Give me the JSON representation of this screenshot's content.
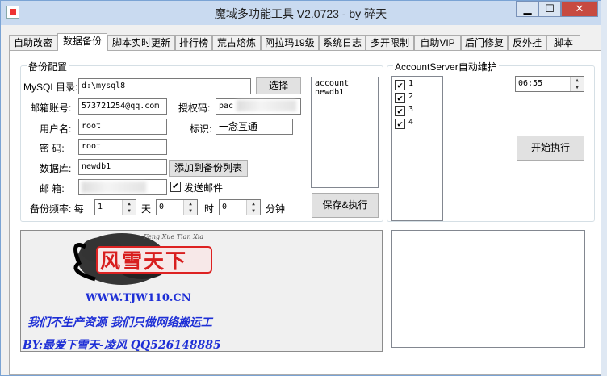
{
  "window": {
    "title": "魔域多功能工具 V2.0723 - by 碎天",
    "min_label": "▁",
    "max_label": "☐",
    "close_label": "✕"
  },
  "tabs": [
    {
      "label": "自助改密"
    },
    {
      "label": "数据备份"
    },
    {
      "label": "脚本实时更新"
    },
    {
      "label": "排行榜"
    },
    {
      "label": "荒古熔炼"
    },
    {
      "label": "阿拉玛19级"
    },
    {
      "label": "系统日志"
    },
    {
      "label": "多开限制"
    },
    {
      "label": "自助VIP"
    },
    {
      "label": "后门修复"
    },
    {
      "label": "反外挂"
    },
    {
      "label": "脚本"
    }
  ],
  "backup": {
    "group_title": "备份配置",
    "mysql_label": "MySQL目录:",
    "mysql_value": "d:\\mysql8",
    "browse_label": "选择",
    "email_account_label": "邮箱账号:",
    "email_account_value": "573721254@qq.com",
    "auth_code_label": "授权码:",
    "auth_code_value": "pac",
    "username_label": "用户名:",
    "username_value": "root",
    "tag_label": "标识:",
    "tag_value": "一念互通",
    "password_label": "密  码:",
    "password_value": "root",
    "database_label": "数据库:",
    "database_value": "newdb1",
    "add_to_list_label": "添加到备份列表",
    "mailbox_label": "邮  箱:",
    "send_mail_label": "发送邮件",
    "frequency_label": "备份频率: 每",
    "freq_day_value": "1",
    "freq_day_unit": "天",
    "freq_hour_value": "0",
    "freq_hour_unit": "时",
    "freq_min_value": "0",
    "freq_min_unit": "分钟",
    "save_execute_label": "保存&执行",
    "db_list": [
      "account",
      "newdb1"
    ]
  },
  "account_server": {
    "group_title": "AccountServer自动维护",
    "items": [
      "1",
      "2",
      "3",
      "4"
    ],
    "time_value": "06:55",
    "start_label": "开始执行"
  },
  "banner": {
    "brand_cn": "风雪天下",
    "brand_en": "Feng Xue Tian Xia",
    "website": "WWW.TJW110.CN",
    "slogan": "我们不生产资源  我们只做网络搬运工",
    "author": "BY:最爱下雪天-凌风 QQ526148885"
  }
}
